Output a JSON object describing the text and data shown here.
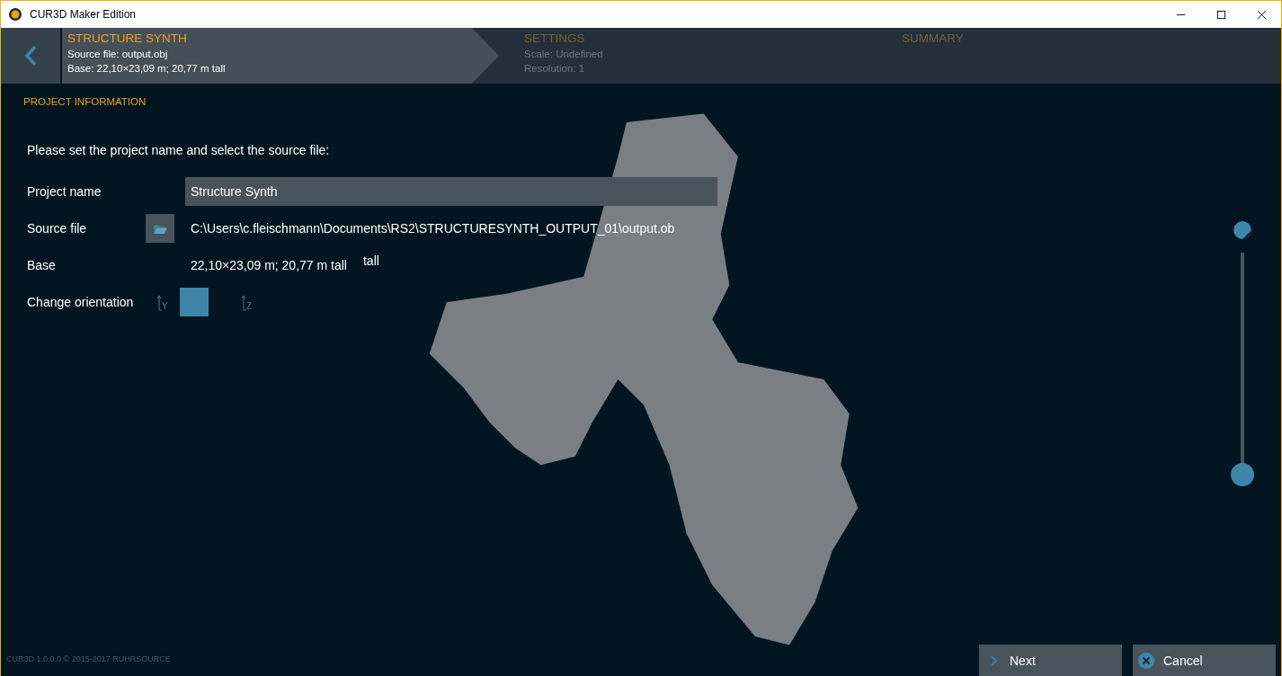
{
  "window": {
    "title": "CUR3D Maker Edition"
  },
  "steps": [
    {
      "title": "STRUCTURE SYNTH",
      "lines": [
        "Source file:  output.obj",
        "Base:  22,10×23,09 m; 20,77 m tall"
      ],
      "selected": true
    },
    {
      "title": "SETTINGS",
      "lines": [
        "Scale:  Undefined",
        "Resolution:  1"
      ],
      "selected": false
    },
    {
      "title": "SUMMARY",
      "selected": false
    }
  ],
  "section_title": "PROJECT INFORMATION",
  "instruction": "Please set the project name and select the source file:",
  "project_name": {
    "label": "Project name",
    "value": "Structure Synth"
  },
  "source_file": {
    "label": "Source file",
    "value": "C:\\Users\\c.fleischmann\\Documents\\RS2\\STRUCTURESYNTH_OUTPUT_01\\output.ob"
  },
  "base": {
    "label": "Base",
    "value": "22,10×23,09 m; 20,77 m tall",
    "extra": "tall"
  },
  "orientation": {
    "label": "Change orientation",
    "options": [
      {
        "label": "Y",
        "selected": true
      },
      {
        "label": "Z",
        "selected": false
      }
    ]
  },
  "zoom_slider": {
    "level": 0
  },
  "footer": "CUR3D  1.0.0.0  © 2015-2017 RUHRSOURCE",
  "buttons": [
    {
      "label": "Next",
      "kind": "next"
    },
    {
      "label": "Cancel",
      "kind": "cancel"
    }
  ]
}
